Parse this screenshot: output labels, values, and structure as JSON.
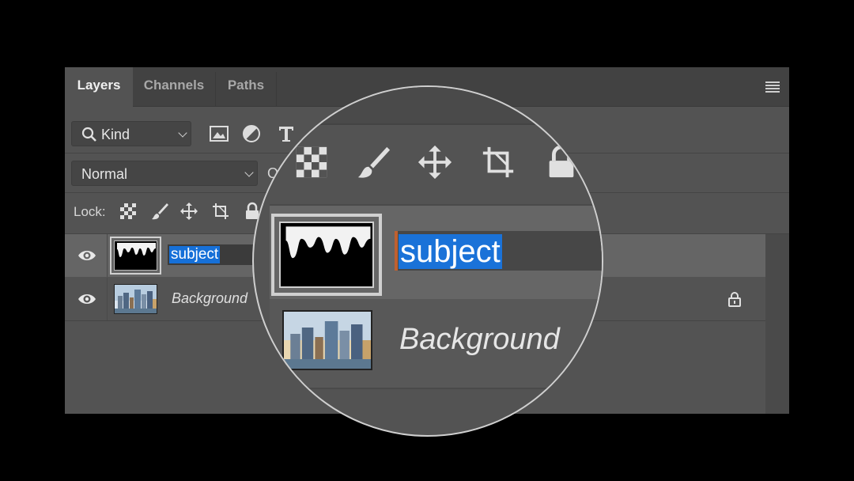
{
  "tabs": [
    {
      "label": "Layers",
      "active": true
    },
    {
      "label": "Channels",
      "active": false
    },
    {
      "label": "Paths",
      "active": false
    }
  ],
  "filter": {
    "kind_label": "Kind",
    "icons": [
      "search-icon",
      "image-filter-icon",
      "adjustment-filter-icon",
      "type-filter-icon"
    ]
  },
  "blend": {
    "mode": "Normal",
    "opacity_label_partial": "O"
  },
  "lock": {
    "label": "Lock:",
    "icons": [
      "lock-transparent-icon",
      "lock-paint-icon",
      "lock-move-icon",
      "lock-artboard-icon",
      "lock-all-icon"
    ]
  },
  "layers": [
    {
      "name": "subject",
      "selected": true,
      "editing": true,
      "visible": true,
      "thumbnail": "mask-icon"
    },
    {
      "name": "Background",
      "selected": false,
      "locked": true,
      "visible": true,
      "thumbnail": "city-skyline-icon"
    }
  ],
  "magnifier": {
    "layer_name": "subject",
    "background_name": "Background"
  },
  "colors": {
    "panel": "#535353",
    "selection": "#1670d8",
    "selected_row": "#656565"
  }
}
